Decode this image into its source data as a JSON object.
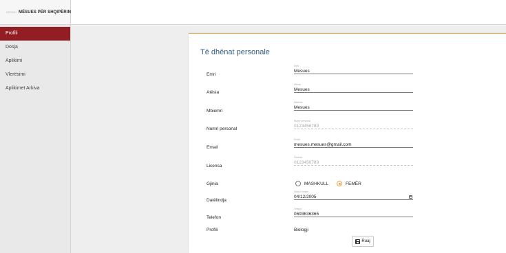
{
  "sidebar": {
    "logo_text": "ARSIMI",
    "brand": "MËSUES PËR SHQIPËRINË",
    "items": [
      {
        "label": "Profili",
        "active": true
      },
      {
        "label": "Dosja",
        "active": false
      },
      {
        "label": "Aplikimi",
        "active": false
      },
      {
        "label": "Vlerësimi",
        "active": false
      },
      {
        "label": "Aplikimet Arkiva",
        "active": false
      }
    ]
  },
  "form": {
    "title": "Të dhënat personale",
    "rows": [
      {
        "label": "Emri",
        "floating": "Emri",
        "value": "Mesues",
        "disabled": false
      },
      {
        "label": "Atësia",
        "floating": "Atësia",
        "value": "Mesues",
        "disabled": false
      },
      {
        "label": "Mbiemri",
        "floating": "Mbiemri",
        "value": "Mesues",
        "disabled": false
      },
      {
        "label": "Numri personal",
        "floating": "Numri personal",
        "value": "0123456789",
        "disabled": true
      },
      {
        "label": "Email",
        "floating": "Email",
        "value": "mesues.mesues@gmail.com",
        "disabled": false
      },
      {
        "label": "Licensa",
        "floating": "Licensa",
        "value": "0123456789",
        "disabled": true
      }
    ],
    "gender": {
      "label": "Gjinia",
      "options": [
        "MASHKULL",
        "FEMËR"
      ],
      "selected": "FEMËR"
    },
    "birthdate": {
      "label": "Datëlindja",
      "floating": "Data e lindjes",
      "value": "04/12/2005"
    },
    "phone": {
      "label": "Telefon",
      "floating": "Telefon",
      "value": "0693636365"
    },
    "profile": {
      "label": "Profili",
      "value": "Biologji"
    },
    "save_label": "Ruaj"
  },
  "colors": {
    "active_nav": "#921d22",
    "accent": "#f0a24b",
    "title": "#2f5e84"
  }
}
